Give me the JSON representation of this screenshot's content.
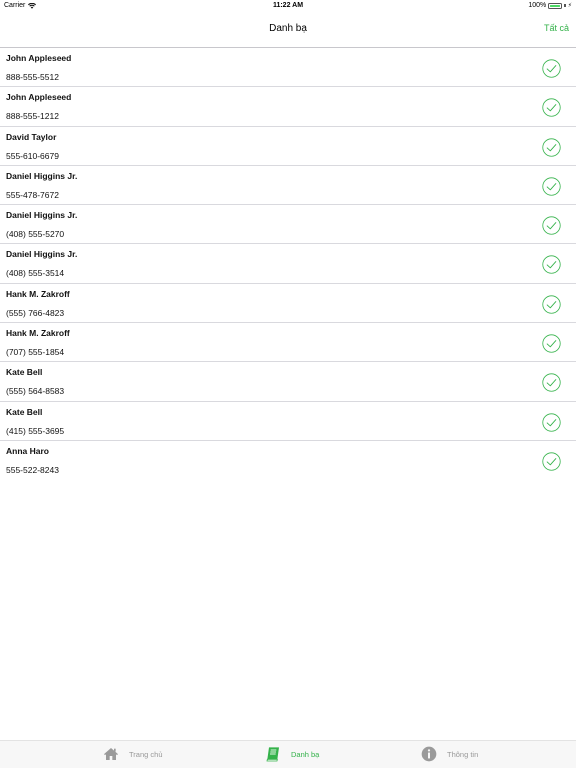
{
  "status_bar": {
    "carrier": "Carrier",
    "time": "11:22 AM",
    "battery": "100%"
  },
  "nav": {
    "title": "Danh bạ",
    "action": "Tất cả"
  },
  "contacts": [
    {
      "name": "John Appleseed",
      "phone": "888-555-5512",
      "selected": true
    },
    {
      "name": "John Appleseed",
      "phone": "888-555-1212",
      "selected": true
    },
    {
      "name": "David Taylor",
      "phone": "555-610-6679",
      "selected": true
    },
    {
      "name": "Daniel Higgins Jr.",
      "phone": "555-478-7672",
      "selected": true
    },
    {
      "name": "Daniel Higgins Jr.",
      "phone": "(408) 555-5270",
      "selected": true
    },
    {
      "name": "Daniel Higgins Jr.",
      "phone": "(408) 555-3514",
      "selected": true
    },
    {
      "name": "Hank M. Zakroff",
      "phone": "(555) 766-4823",
      "selected": true
    },
    {
      "name": "Hank M. Zakroff",
      "phone": "(707) 555-1854",
      "selected": true
    },
    {
      "name": "Kate Bell",
      "phone": "(555) 564-8583",
      "selected": true
    },
    {
      "name": "Kate Bell",
      "phone": "(415) 555-3695",
      "selected": true
    },
    {
      "name": "Anna Haro",
      "phone": "555-522-8243",
      "selected": true
    }
  ],
  "tabs": [
    {
      "label": "Trang chủ",
      "icon": "home-icon",
      "active": false
    },
    {
      "label": "Danh bạ",
      "icon": "contacts-book-icon",
      "active": true
    },
    {
      "label": "Thông tin",
      "icon": "info-icon",
      "active": false
    }
  ],
  "colors": {
    "accent": "#34b24a",
    "inactive": "#999999",
    "separator": "#d9d9de"
  }
}
